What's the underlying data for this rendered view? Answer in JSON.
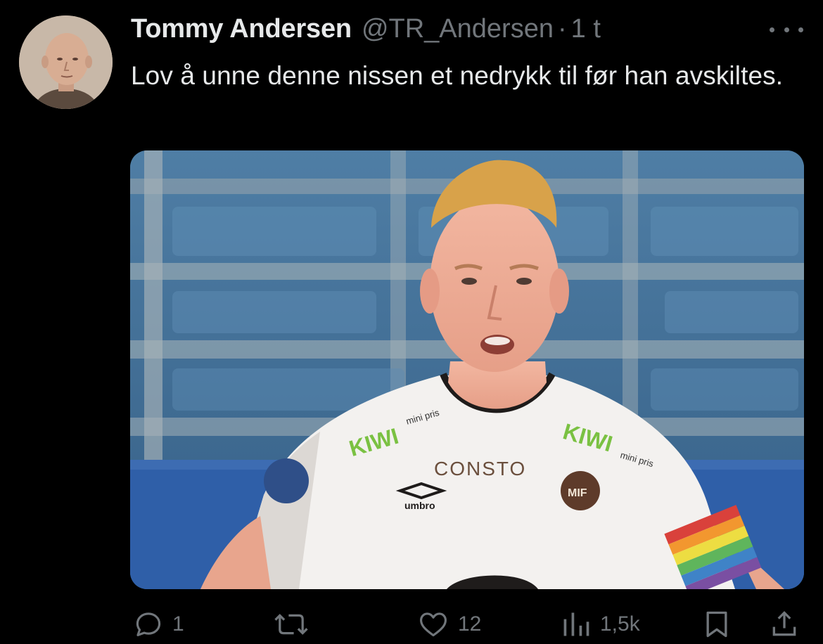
{
  "tweet": {
    "author": {
      "display_name": "Tommy Andersen",
      "handle": "@TR_Andersen",
      "separator": "·",
      "time": "1 t"
    },
    "text": "Lov å unne denne nissen et nedrykk til før han avskiltes.",
    "media": {
      "sponsor_left": "KIWI",
      "sponsor_left_small": "mini pris",
      "sponsor_right": "KIWI",
      "sponsor_right_small": "mini pris",
      "shirt_text": "CONSTO",
      "kit_brand": "umbro",
      "club_crest": "MIF"
    },
    "actions": {
      "replies": "1",
      "reposts": "",
      "likes": "12",
      "views": "1,5k"
    },
    "icons": {
      "more": "more-icon",
      "reply": "reply-icon",
      "repost": "repost-icon",
      "like": "like-icon",
      "views": "views-icon",
      "bookmark": "bookmark-icon",
      "share": "share-icon"
    }
  },
  "colors": {
    "background": "#000000",
    "text_primary": "#e7e9ea",
    "text_secondary": "#71767b"
  }
}
